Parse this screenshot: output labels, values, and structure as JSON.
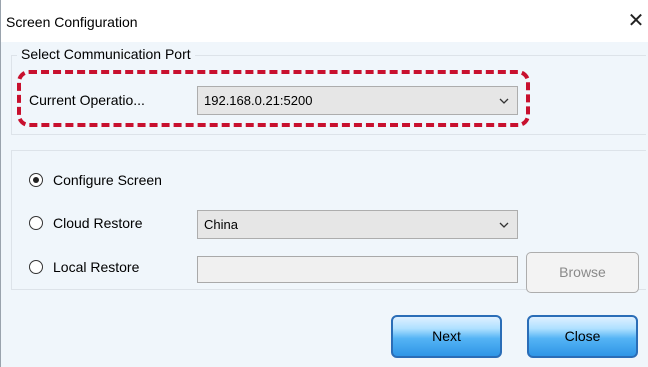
{
  "window": {
    "title": "Screen Configuration",
    "close_symbol": "✕"
  },
  "comm_group": {
    "legend": "Select Communication Port",
    "current_operation_label": "Current Operatio...",
    "current_operation_value": "192.168.0.21:5200"
  },
  "config_group": {
    "options": [
      {
        "label": "Configure Screen",
        "checked": true
      },
      {
        "label": "Cloud Restore",
        "checked": false
      },
      {
        "label": "Local Restore",
        "checked": false
      }
    ],
    "cloud_region_value": "China",
    "local_path_value": "",
    "browse_label": "Browse"
  },
  "buttons": {
    "next_label": "Next",
    "close_label": "Close"
  },
  "colors": {
    "highlight": "#c8102e",
    "button_blue": "#2f95e6"
  }
}
